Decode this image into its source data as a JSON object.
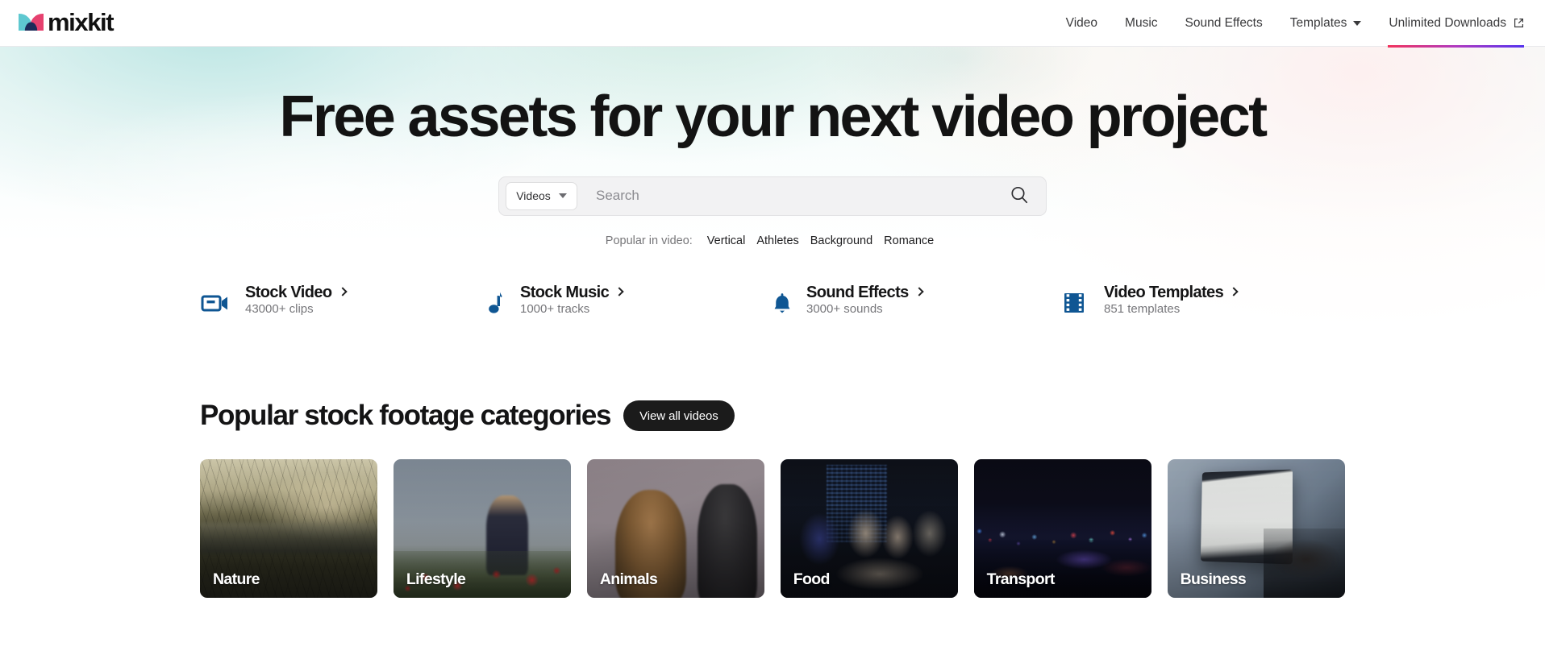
{
  "brand": {
    "name": "mixkit",
    "logo_icon": "mixkit-logo-mark",
    "colors": {
      "teal": "#5ec8d0",
      "pink": "#e6416f",
      "navy": "#1d2b59"
    }
  },
  "nav": {
    "items": [
      {
        "label": "Video",
        "icon": null,
        "has_caret": false,
        "active": false
      },
      {
        "label": "Music",
        "icon": null,
        "has_caret": false,
        "active": false
      },
      {
        "label": "Sound Effects",
        "icon": null,
        "has_caret": false,
        "active": false
      },
      {
        "label": "Templates",
        "icon": "chevron-down-icon",
        "has_caret": true,
        "active": false
      },
      {
        "label": "Unlimited Downloads",
        "icon": "external-link-icon",
        "has_caret": false,
        "active": true
      }
    ],
    "active_underline_gradient": [
      "#f2335c",
      "#b03ac0",
      "#5533ee"
    ]
  },
  "hero": {
    "title": "Free assets for your next video project",
    "search": {
      "category_value": "Videos",
      "category_icon": "chevron-down-icon",
      "placeholder": "Search",
      "value": "",
      "submit_icon": "search-icon"
    },
    "popular": {
      "label": "Popular in video:",
      "tags": [
        "Vertical",
        "Athletes",
        "Background",
        "Romance"
      ]
    },
    "quick_links": [
      {
        "icon": "video-camera-icon",
        "title": "Stock Video",
        "chevron": "chevron-right-icon",
        "subtitle": "43000+ clips"
      },
      {
        "icon": "music-note-icon",
        "title": "Stock Music",
        "chevron": "chevron-right-icon",
        "subtitle": "1000+ tracks"
      },
      {
        "icon": "bell-icon",
        "title": "Sound Effects",
        "chevron": "chevron-right-icon",
        "subtitle": "3000+ sounds"
      },
      {
        "icon": "film-strip-icon",
        "title": "Video Templates",
        "chevron": "chevron-right-icon",
        "subtitle": "851 templates"
      }
    ],
    "icon_color": "#0f5693"
  },
  "categories": {
    "heading": "Popular stock footage categories",
    "view_all_label": "View all videos",
    "cards": [
      {
        "label": "Nature",
        "art": "img-nature"
      },
      {
        "label": "Lifestyle",
        "art": "img-lifestyle"
      },
      {
        "label": "Animals",
        "art": "img-animals"
      },
      {
        "label": "Food",
        "art": "img-food"
      },
      {
        "label": "Transport",
        "art": "img-transport"
      },
      {
        "label": "Business",
        "art": "img-business"
      }
    ]
  }
}
